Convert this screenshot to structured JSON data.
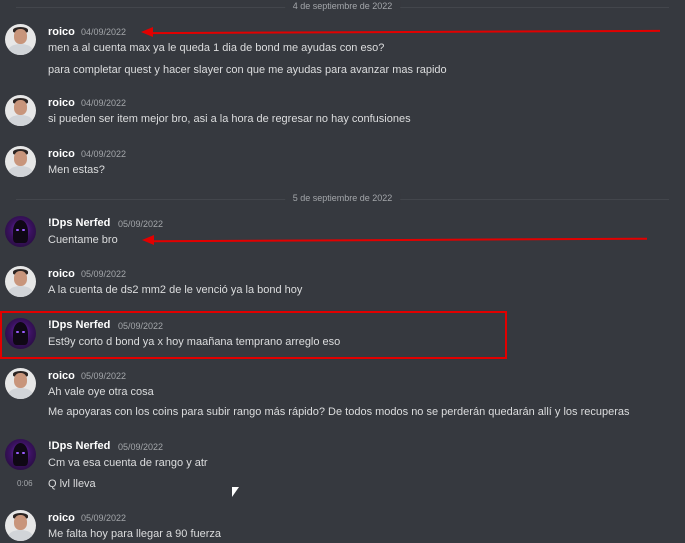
{
  "dividers": [
    "4 de septiembre de 2022",
    "5 de septiembre de 2022"
  ],
  "messages": [
    {
      "author": "roico",
      "time": "04/09/2022",
      "lines": [
        "men a al cuenta max ya le queda 1 dia de bond me ayudas con eso?",
        "para completar quest y hacer slayer con que me ayudas para avanzar mas rapido"
      ]
    },
    {
      "author": "roico",
      "time": "04/09/2022",
      "lines": [
        "si pueden ser item mejor bro, asi a la hora de regresar no hay confusiones"
      ]
    },
    {
      "author": "roico",
      "time": "04/09/2022",
      "lines": [
        "Men estas?"
      ]
    },
    {
      "author": "!Dps Nerfed",
      "time": "05/09/2022",
      "lines": [
        "Cuentame bro"
      ]
    },
    {
      "author": "roico",
      "time": "05/09/2022",
      "lines": [
        "A la cuenta de ds2 mm2 de le venció ya la bond hoy"
      ]
    },
    {
      "author": "!Dps Nerfed",
      "time": "05/09/2022",
      "lines": [
        "Est9y corto d bond ya x hoy maañana temprano arreglo eso"
      ]
    },
    {
      "author": "roico",
      "time": "05/09/2022",
      "lines": [
        "Ah vale oye otra cosa",
        "Me apoyaras con los coins para subir rango más rápido? De todos  modos no se perderán quedarán allí y los recuperas"
      ]
    },
    {
      "author": "!Dps Nerfed",
      "time": "05/09/2022",
      "lines": [
        "Cm va esa cuenta de rango y atr",
        "Q lvl lleva"
      ],
      "inline_time": "0:06"
    },
    {
      "author": "roico",
      "time": "05/09/2022",
      "lines": [
        "Me falta hoy para llegar a 90 fuerza"
      ]
    }
  ],
  "colors": {
    "background": "#36393f",
    "text": "#dcddde",
    "muted": "#a3a6aa",
    "annotation": "#e20000"
  }
}
